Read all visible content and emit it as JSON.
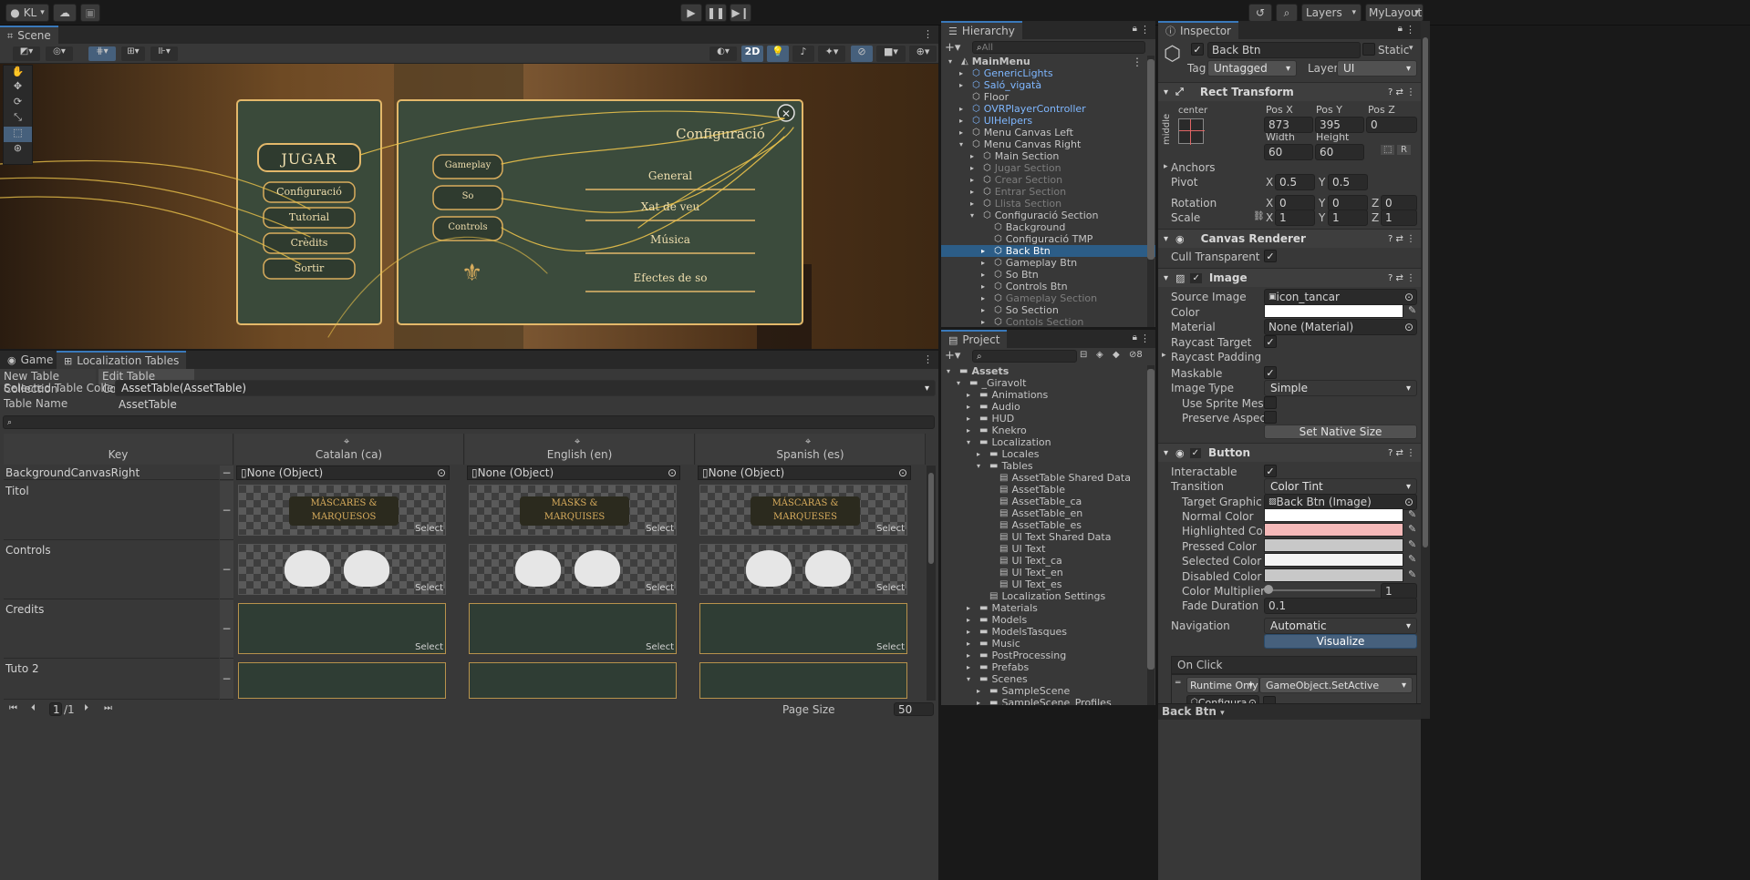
{
  "toolbar": {
    "account": "KL",
    "layers": "Layers",
    "layout": "MyLayout"
  },
  "scene": {
    "tab": "Scene",
    "btn_2d": "2D",
    "menu_left": {
      "title": "JUGAR",
      "items": [
        "Configuració",
        "Tutorial",
        "Crèdits",
        "Sortir"
      ]
    },
    "menu_right": {
      "title": "Configuració",
      "tabs": [
        "Gameplay",
        "So",
        "Controls"
      ],
      "sliders": [
        "General",
        "Xat de veu",
        "Música",
        "Efectes de so"
      ]
    }
  },
  "bottom": {
    "tabs": [
      "Game",
      "Localization Tables"
    ],
    "new_collection": "New Table Collection",
    "edit_collection": "Edit Table Collection",
    "selected_label": "Selected Table Collection",
    "selected_value": "AssetTable(AssetTable)",
    "name_label": "Table Name",
    "name_value": "AssetTable",
    "key_header": "Key",
    "columns": [
      "Catalan (ca)",
      "English (en)",
      "Spanish (es)"
    ],
    "rows": [
      {
        "key": "BackgroundCanvasRight",
        "value": "None (Object)"
      },
      {
        "key": "Titol"
      },
      {
        "key": "Controls"
      },
      {
        "key": "Credits"
      },
      {
        "key": "Tuto 2"
      }
    ],
    "title_image": [
      "MÀSCARES & MARQUESOS",
      "MASKS & MARQUISES",
      "MÁSCARAS & MARQUESES"
    ],
    "select_label": "Select",
    "page_current": "1",
    "page_total": "/1",
    "page_size_label": "Page Size",
    "page_size": "50"
  },
  "hierarchy": {
    "tab": "Hierarchy",
    "search_placeholder": "All",
    "items": [
      {
        "label": "MainMenu",
        "depth": 0,
        "type": "scene"
      },
      {
        "label": "GenericLights",
        "depth": 1,
        "type": "prefab"
      },
      {
        "label": "Saló_vigatà",
        "depth": 1,
        "type": "prefab"
      },
      {
        "label": "Floor",
        "depth": 1,
        "type": "go"
      },
      {
        "label": "OVRPlayerController",
        "depth": 1,
        "type": "prefab"
      },
      {
        "label": "UIHelpers",
        "depth": 1,
        "type": "prefab"
      },
      {
        "label": "Menu Canvas Left",
        "depth": 1,
        "type": "go"
      },
      {
        "label": "Menu Canvas Right",
        "depth": 1,
        "type": "go"
      },
      {
        "label": "Main Section",
        "depth": 2,
        "type": "go"
      },
      {
        "label": "Jugar Section",
        "depth": 2,
        "type": "dim"
      },
      {
        "label": "Crear Section",
        "depth": 2,
        "type": "dim"
      },
      {
        "label": "Entrar Section",
        "depth": 2,
        "type": "dim"
      },
      {
        "label": "Llista Section",
        "depth": 2,
        "type": "dim"
      },
      {
        "label": "Configuració Section",
        "depth": 2,
        "type": "go"
      },
      {
        "label": "Background",
        "depth": 3,
        "type": "go"
      },
      {
        "label": "Configuració TMP",
        "depth": 3,
        "type": "go"
      },
      {
        "label": "Back Btn",
        "depth": 3,
        "type": "selected"
      },
      {
        "label": "Gameplay Btn",
        "depth": 3,
        "type": "go"
      },
      {
        "label": "So Btn",
        "depth": 3,
        "type": "go"
      },
      {
        "label": "Controls Btn",
        "depth": 3,
        "type": "go"
      },
      {
        "label": "Gameplay Section",
        "depth": 3,
        "type": "dim"
      },
      {
        "label": "So Section",
        "depth": 3,
        "type": "go"
      },
      {
        "label": "Contols Section",
        "depth": 3,
        "type": "dim"
      }
    ]
  },
  "project": {
    "tab": "Project",
    "count": "8",
    "items": [
      {
        "label": "Assets",
        "depth": 0,
        "bold": true
      },
      {
        "label": "_Giravolt",
        "depth": 1
      },
      {
        "label": "Animations",
        "depth": 2
      },
      {
        "label": "Audio",
        "depth": 2
      },
      {
        "label": "HUD",
        "depth": 2
      },
      {
        "label": "Knekro",
        "depth": 2
      },
      {
        "label": "Localization",
        "depth": 2
      },
      {
        "label": "Locales",
        "depth": 3
      },
      {
        "label": "Tables",
        "depth": 3
      },
      {
        "label": "AssetTable Shared Data",
        "depth": 4,
        "file": true
      },
      {
        "label": "AssetTable",
        "depth": 4,
        "file": true
      },
      {
        "label": "AssetTable_ca",
        "depth": 4,
        "file": true
      },
      {
        "label": "AssetTable_en",
        "depth": 4,
        "file": true
      },
      {
        "label": "AssetTable_es",
        "depth": 4,
        "file": true
      },
      {
        "label": "UI Text Shared Data",
        "depth": 4,
        "file": true
      },
      {
        "label": "UI Text",
        "depth": 4,
        "file": true
      },
      {
        "label": "UI Text_ca",
        "depth": 4,
        "file": true
      },
      {
        "label": "UI Text_en",
        "depth": 4,
        "file": true
      },
      {
        "label": "UI Text_es",
        "depth": 4,
        "file": true
      },
      {
        "label": "Localization Settings",
        "depth": 3,
        "file": true
      },
      {
        "label": "Materials",
        "depth": 2
      },
      {
        "label": "Models",
        "depth": 2
      },
      {
        "label": "ModelsTasques",
        "depth": 2
      },
      {
        "label": "Music",
        "depth": 2
      },
      {
        "label": "PostProcessing",
        "depth": 2
      },
      {
        "label": "Prefabs",
        "depth": 2
      },
      {
        "label": "Scenes",
        "depth": 2
      },
      {
        "label": "SampleScene",
        "depth": 3
      },
      {
        "label": "SampleScene_Profiles",
        "depth": 3
      }
    ]
  },
  "inspector": {
    "tab": "Inspector",
    "object_name": "Back Btn",
    "static_label": "Static",
    "tag_label": "Tag",
    "tag_value": "Untagged",
    "layer_label": "Layer",
    "layer_value": "UI",
    "rect": {
      "title": "Rect Transform",
      "anchor_h": "center",
      "anchor_v": "middle",
      "posx_label": "Pos X",
      "posx": "873",
      "posy_label": "Pos Y",
      "posy": "395",
      "posz_label": "Pos Z",
      "posz": "0",
      "width_label": "Width",
      "width": "60",
      "height_label": "Height",
      "height": "60",
      "anchors": "Anchors",
      "pivot": "Pivot",
      "pivot_x": "0.5",
      "pivot_y": "0.5",
      "rotation": "Rotation",
      "rot_x": "0",
      "rot_y": "0",
      "rot_z": "0",
      "scale": "Scale",
      "scale_x": "1",
      "scale_y": "1",
      "scale_z": "1"
    },
    "canvas_renderer": {
      "title": "Canvas Renderer",
      "cull": "Cull Transparent Mesh"
    },
    "image": {
      "title": "Image",
      "source_label": "Source Image",
      "source_value": "icon_tancar",
      "color_label": "Color",
      "material_label": "Material",
      "material_value": "None (Material)",
      "raycast_target": "Raycast Target",
      "raycast_padding": "Raycast Padding",
      "maskable": "Maskable",
      "image_type_label": "Image Type",
      "image_type_value": "Simple",
      "use_sprite_mesh": "Use Sprite Mesh",
      "preserve_aspect": "Preserve Aspect",
      "set_native": "Set Native Size"
    },
    "button": {
      "title": "Button",
      "interactable": "Interactable",
      "transition_label": "Transition",
      "transition_value": "Color Tint",
      "target_label": "Target Graphic",
      "target_value": "Back Btn (Image)",
      "normal_label": "Normal Color",
      "normal_color": "#ffffff",
      "highlighted_label": "Highlighted Color",
      "highlighted_color": "#f5b9b9",
      "pressed_label": "Pressed Color",
      "pressed_color": "#c8c8c8",
      "selected_label": "Selected Color",
      "selected_color": "#f5f5f5",
      "disabled_label": "Disabled Color",
      "disabled_color": "#c8c8c8",
      "multiplier_label": "Color Multiplier",
      "multiplier_value": "1",
      "fade_label": "Fade Duration",
      "fade_value": "0.1",
      "navigation_label": "Navigation",
      "navigation_value": "Automatic",
      "visualize": "Visualize",
      "onclick": "On Click",
      "runtime": "Runtime Only",
      "method": "GameObject.SetActive",
      "target_obj": "Configura"
    },
    "footer": "Back Btn"
  },
  "colors": {
    "accent": "#3a79bb",
    "selection": "#2c5d87",
    "prefab": "#7fb7ff"
  }
}
